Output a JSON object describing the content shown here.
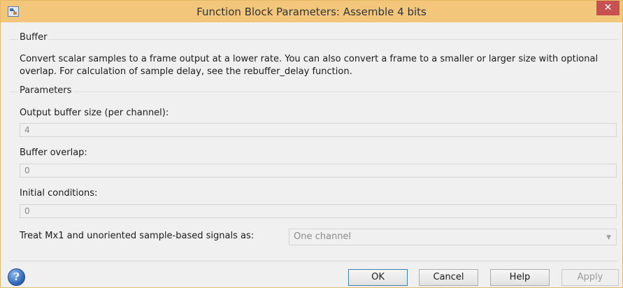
{
  "window": {
    "title": "Function Block Parameters: Assemble 4 bits",
    "close_glyph": "✕",
    "app_icon": "simulink-block-icon"
  },
  "buffer_group": {
    "title": "Buffer",
    "description": "Convert scalar samples to a frame output at a lower rate. You can also convert a frame to a smaller or larger size with optional overlap. For calculation of sample delay, see the rebuffer_delay function."
  },
  "parameters_group": {
    "title": "Parameters",
    "fields": [
      {
        "label": "Output buffer size (per channel):",
        "value": "4"
      },
      {
        "label": "Buffer overlap:",
        "value": "0"
      },
      {
        "label": "Initial conditions:",
        "value": "0"
      }
    ],
    "treat_label": "Treat Mx1 and unoriented sample-based signals as:",
    "treat_value": "One channel"
  },
  "buttons": {
    "ok": "OK",
    "cancel": "Cancel",
    "help": "Help",
    "apply": "Apply"
  },
  "help_icon_glyph": "?"
}
